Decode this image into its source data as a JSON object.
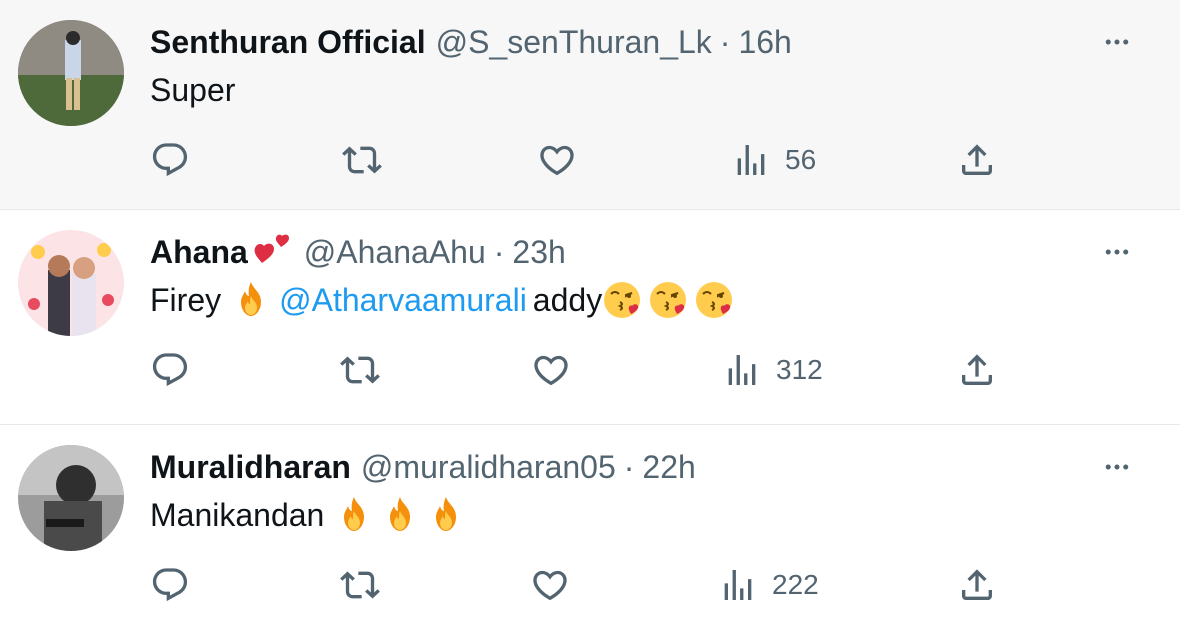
{
  "tweets": [
    {
      "name": "Senthuran Official",
      "handle": "@S_senThuran_Lk",
      "dot": "·",
      "time": "16h",
      "text": "Super",
      "views": "56",
      "highlighted": true
    },
    {
      "name": "Ahana",
      "handle": "@AhanaAhu",
      "dot": "·",
      "time": "23h",
      "text_pre": "Firey",
      "mention": "@Atharvaamurali",
      "text_post": "addy",
      "views": "312"
    },
    {
      "name": "Muralidharan",
      "handle": "@muralidharan05",
      "dot": "·",
      "time": "22h",
      "text": "Manikandan",
      "views": "222"
    }
  ],
  "icons": {
    "reply": "reply-icon",
    "retweet": "retweet-icon",
    "like": "like-icon",
    "views": "views-icon",
    "share": "share-icon",
    "more": "more-icon"
  },
  "colors": {
    "link": "#1d9bf0",
    "secondary": "#536471",
    "highlight_bg": "#f7f7f7"
  }
}
